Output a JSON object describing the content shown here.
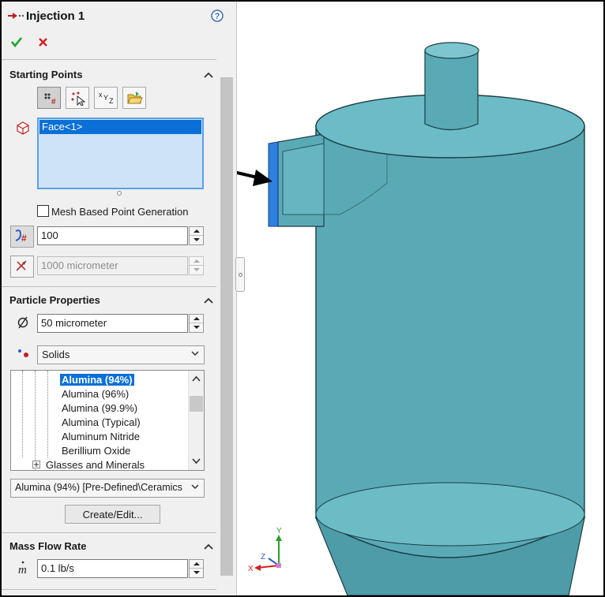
{
  "header": {
    "title": "Injection 1"
  },
  "starting_points": {
    "title": "Starting Points",
    "faces": [
      "Face<1>"
    ],
    "mesh_based_label": "Mesh Based Point Generation",
    "mesh_based_checked": false,
    "number_of_points": "100",
    "distance": "1000 micrometer"
  },
  "particle_properties": {
    "title": "Particle Properties",
    "diameter": "50 micrometer",
    "material_type": "Solids",
    "materials": [
      "Alumina (94%)",
      "Alumina (96%)",
      "Alumina (99.9%)",
      "Alumina (Typical)",
      "Aluminum Nitride",
      "Berillium Oxide"
    ],
    "selected_material": "Alumina (94%)",
    "tree_group": "Glasses and Minerals",
    "selected_path": "Alumina (94%) [Pre-Defined\\Ceramics",
    "create_edit_label": "Create/Edit..."
  },
  "mass_flow_rate": {
    "title": "Mass Flow Rate",
    "value": "0.1 lb/s"
  },
  "triad": {
    "x": "X",
    "y": "Y",
    "z": "Z"
  },
  "icons": {
    "header": "injection-icon",
    "help": "help-icon",
    "ok": "checkmark-icon",
    "cancel": "close-icon"
  },
  "colors": {
    "selection": "#0a6fd6",
    "model": "#5aafbb",
    "ok": "#1aa32a",
    "cancel": "#d21f1f"
  }
}
